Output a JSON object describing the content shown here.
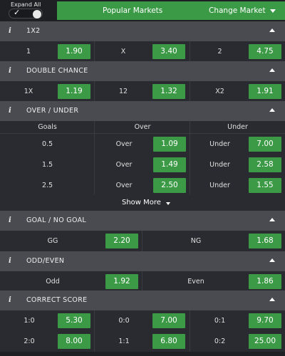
{
  "topbar": {
    "expand_all_label": "Expand All",
    "toggle_check": "✓",
    "popular_markets": "Popular Markets",
    "change_market": "Change Market"
  },
  "info_glyph": "i",
  "markets": {
    "one_x_two": {
      "title": "1X2",
      "outcomes": [
        {
          "label": "1",
          "odd": "1.90"
        },
        {
          "label": "X",
          "odd": "3.40"
        },
        {
          "label": "2",
          "odd": "4.75"
        }
      ]
    },
    "double_chance": {
      "title": "DOUBLE CHANCE",
      "outcomes": [
        {
          "label": "1X",
          "odd": "1.19"
        },
        {
          "label": "12",
          "odd": "1.32"
        },
        {
          "label": "X2",
          "odd": "1.91"
        }
      ]
    },
    "over_under": {
      "title": "OVER / UNDER",
      "headers": [
        "Goals",
        "Over",
        "Under"
      ],
      "rows": [
        {
          "goals": "0.5",
          "over_label": "Over",
          "over_odd": "1.09",
          "under_label": "Under",
          "under_odd": "7.00"
        },
        {
          "goals": "1.5",
          "over_label": "Over",
          "over_odd": "1.49",
          "under_label": "Under",
          "under_odd": "2.58"
        },
        {
          "goals": "2.5",
          "over_label": "Over",
          "over_odd": "2.50",
          "under_label": "Under",
          "under_odd": "1.55"
        }
      ],
      "show_more": "Show More"
    },
    "goal_no_goal": {
      "title": "GOAL / NO GOAL",
      "outcomes": [
        {
          "label": "GG",
          "odd": "2.20"
        },
        {
          "label": "NG",
          "odd": "1.68"
        }
      ]
    },
    "odd_even": {
      "title": "ODD/EVEN",
      "outcomes": [
        {
          "label": "Odd",
          "odd": "1.92"
        },
        {
          "label": "Even",
          "odd": "1.86"
        }
      ]
    },
    "correct_score": {
      "title": "CORRECT SCORE",
      "rows": [
        [
          {
            "label": "1:0",
            "odd": "5.30"
          },
          {
            "label": "0:0",
            "odd": "7.00"
          },
          {
            "label": "0:1",
            "odd": "9.70"
          }
        ],
        [
          {
            "label": "2:0",
            "odd": "8.00"
          },
          {
            "label": "1:1",
            "odd": "6.80"
          },
          {
            "label": "0:2",
            "odd": "25.00"
          }
        ]
      ]
    }
  },
  "colors": {
    "accent_green": "#3c9a47",
    "header_bg": "#4a4b51",
    "row_bg": "#2a2b30",
    "page_bg": "#1f2024"
  }
}
